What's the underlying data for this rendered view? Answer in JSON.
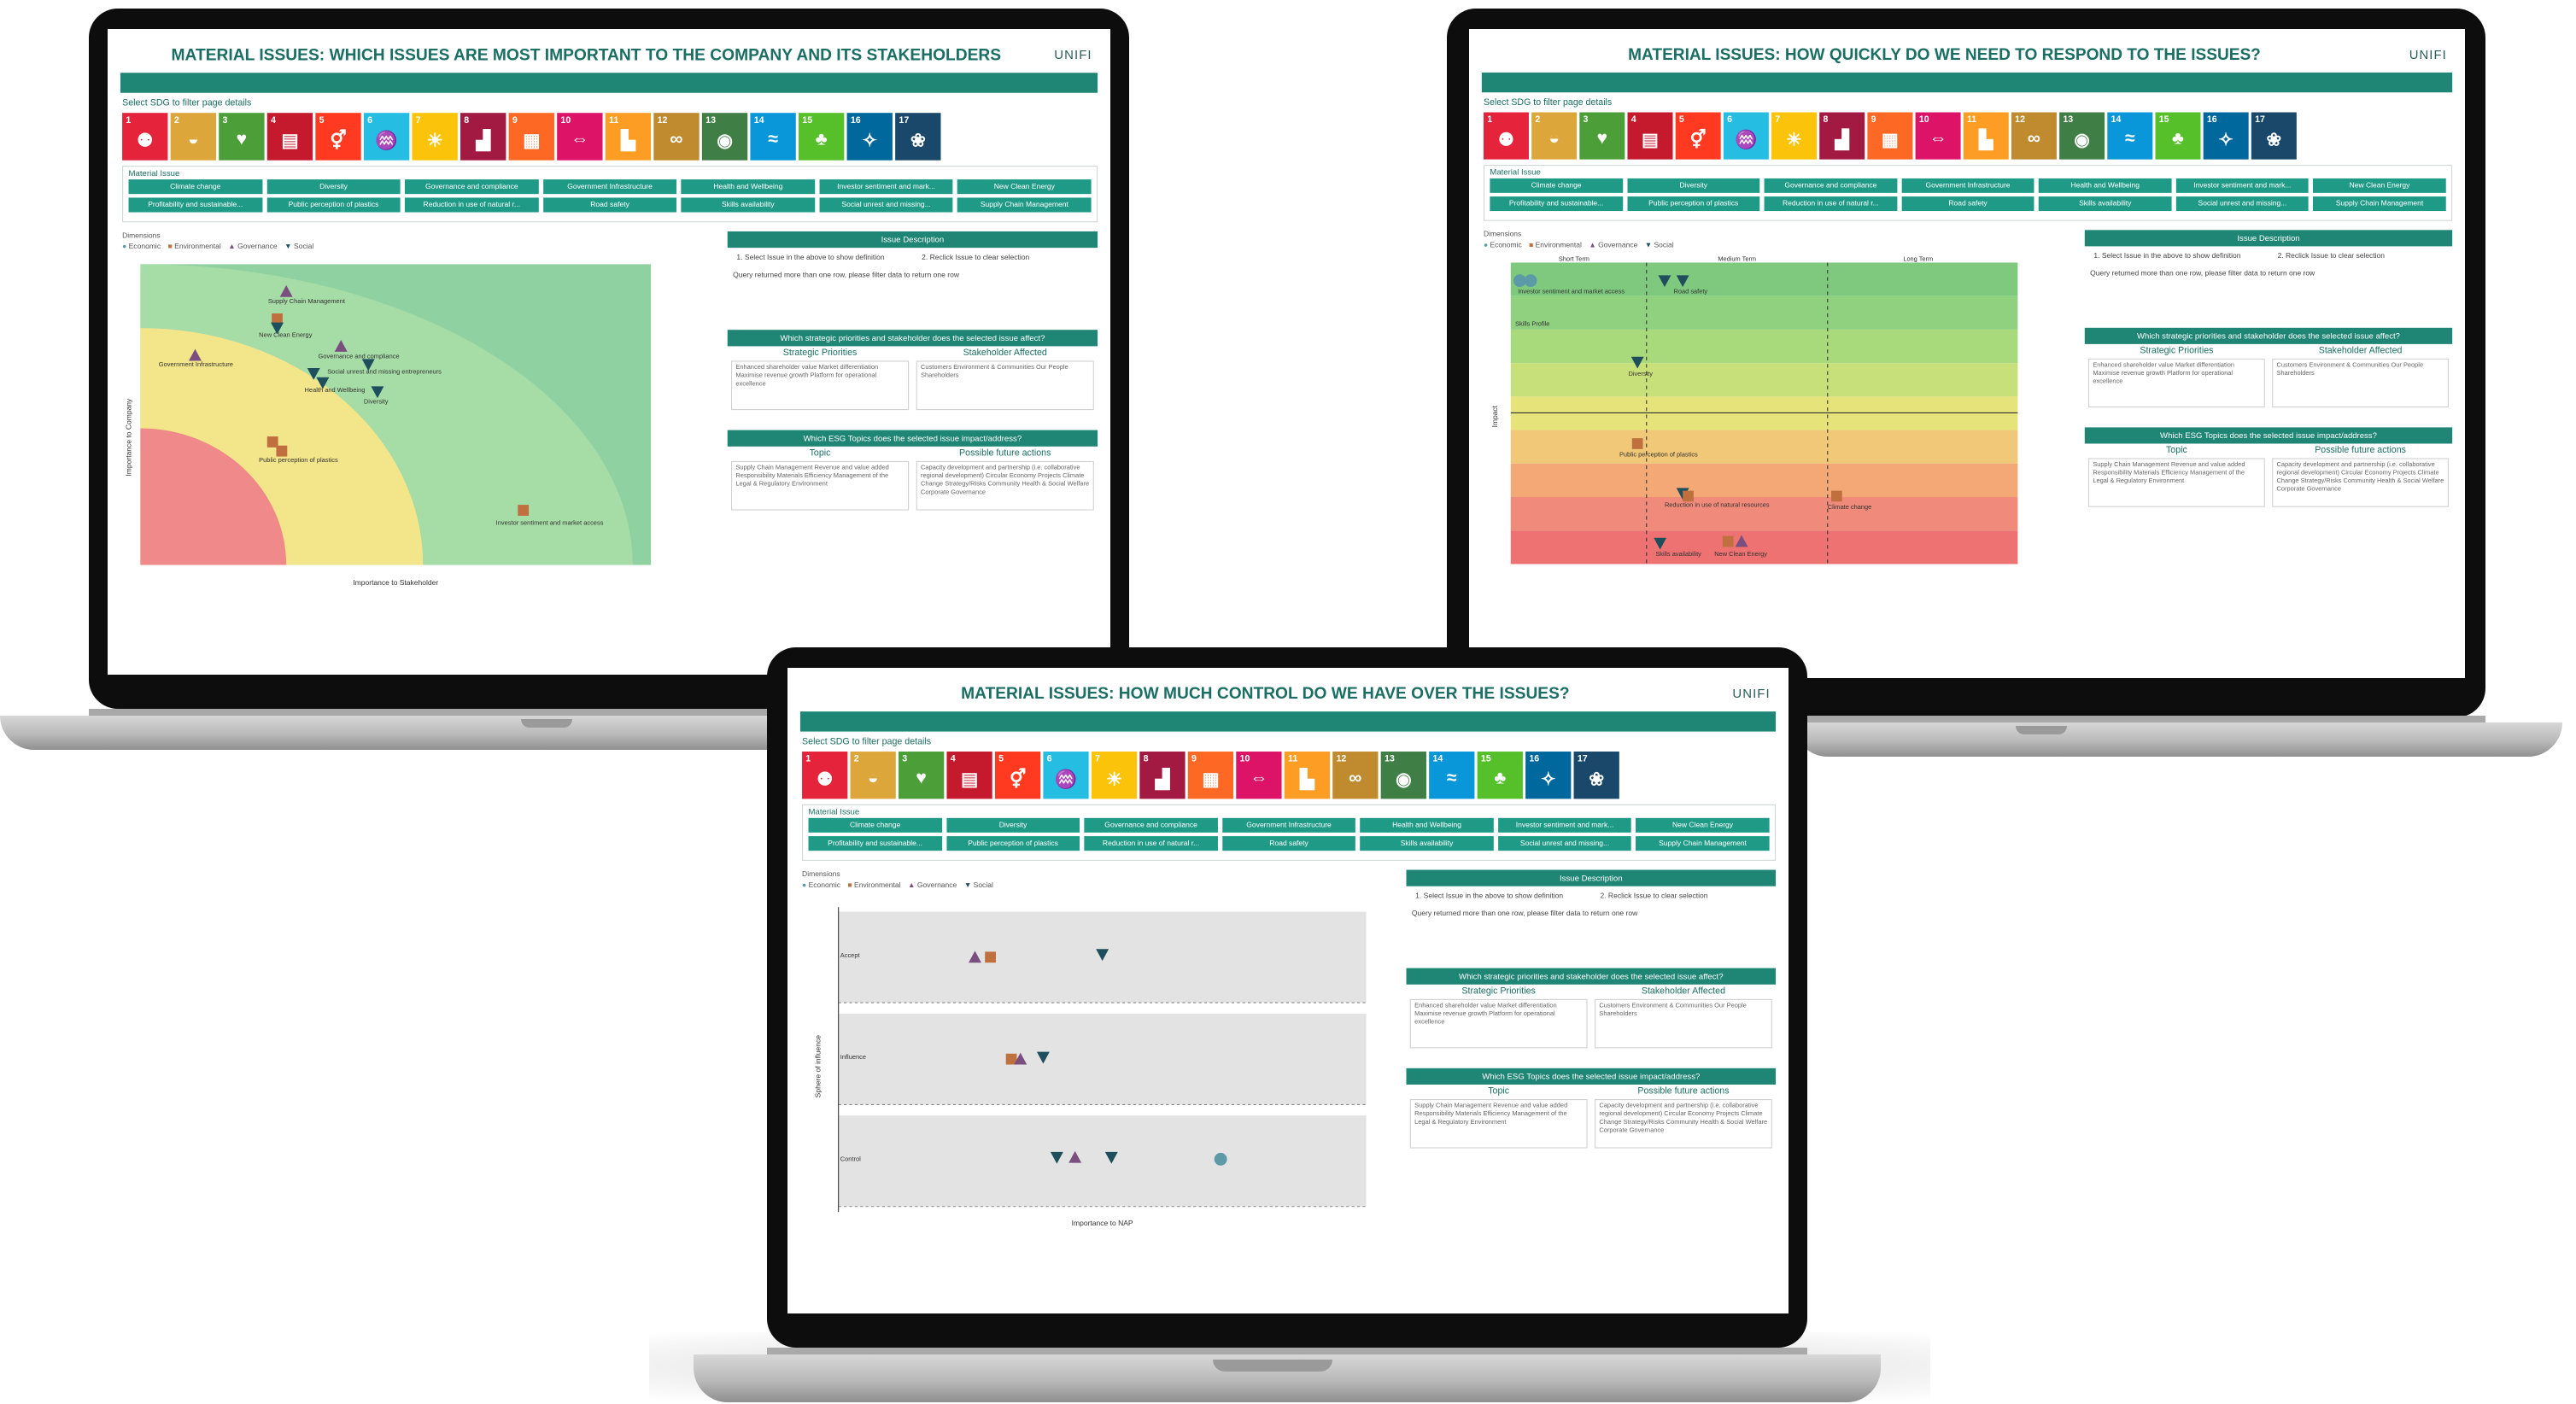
{
  "brand": {
    "logo": "UNIFI"
  },
  "colors": {
    "teal": "#1f8574",
    "title": "#1a6e63"
  },
  "common": {
    "sdg_prompt": "Select SDG to filter page details",
    "sdg_tiles": [
      {
        "n": "1",
        "color": "#e5243b",
        "icon": "people-icon"
      },
      {
        "n": "2",
        "color": "#dda63a",
        "icon": "bowl-icon"
      },
      {
        "n": "3",
        "color": "#4c9f38",
        "icon": "heartbeat-icon"
      },
      {
        "n": "4",
        "color": "#c5192d",
        "icon": "book-icon"
      },
      {
        "n": "5",
        "color": "#ff3a21",
        "icon": "gender-icon"
      },
      {
        "n": "6",
        "color": "#26bde2",
        "icon": "water-drop-icon"
      },
      {
        "n": "7",
        "color": "#fcc30b",
        "icon": "sun-icon"
      },
      {
        "n": "8",
        "color": "#a21942",
        "icon": "growth-chart-icon"
      },
      {
        "n": "9",
        "color": "#fd6925",
        "icon": "cubes-icon"
      },
      {
        "n": "10",
        "color": "#dd1367",
        "icon": "equality-icon"
      },
      {
        "n": "11",
        "color": "#fd9d24",
        "icon": "city-icon"
      },
      {
        "n": "12",
        "color": "#bf8b2e",
        "icon": "infinity-icon"
      },
      {
        "n": "13",
        "color": "#3f7e44",
        "icon": "eye-globe-icon"
      },
      {
        "n": "14",
        "color": "#0a97d9",
        "icon": "fish-icon"
      },
      {
        "n": "15",
        "color": "#56c02b",
        "icon": "tree-icon"
      },
      {
        "n": "16",
        "color": "#00689d",
        "icon": "dove-icon"
      },
      {
        "n": "17",
        "color": "#19486a",
        "icon": "flower-icon"
      }
    ],
    "material_issue_label": "Material Issue",
    "material_issues": [
      "Climate change",
      "Diversity",
      "Governance and compliance",
      "Government Infrastructure",
      "Health and Wellbeing",
      "Investor sentiment and mark...",
      "New Clean Energy",
      "Profitability and sustainable...",
      "Public perception of plastics",
      "Reduction in use of natural r...",
      "Road safety",
      "Skills availability",
      "Social unrest and missing...",
      "Supply Chain Management"
    ],
    "dimensions_label": "Dimensions",
    "legend": [
      "Economic",
      "Environmental",
      "Governance",
      "Social"
    ],
    "issue_description_head": "Issue Description",
    "step1": "1. Select Issue in the above to show definition",
    "step2": "2. Reclick Issue to clear selection",
    "query_msg": "Query returned more than one row, please filter data to return one row",
    "strategic_head": "Which strategic priorities and stakeholder does the selected issue affect?",
    "strategic_col": "Strategic Priorities",
    "stakeholder_col": "Stakeholder Affected",
    "strategic_items": "Enhanced shareholder value  Market differentiation  Maximise revenue growth  Platform for operational excellence",
    "stakeholder_items": "Customers  Environment & Communities  Our People  Shareholders",
    "esg_head": "Which ESG Topics does the selected issue impact/address?",
    "topic_col": "Topic",
    "actions_col": "Possible future actions",
    "topic_items": "Supply Chain Management  Revenue and value added  Responsibility  Materials Efficiency  Management of the Legal & Regulatory  Environment",
    "action_items": "Capacity development and partnership (i.e. collaborative regional development)  Circular Economy Projects  Climate Change Strategy/Risks  Community Health & Social Welfare  Corporate Governance"
  },
  "screens": [
    {
      "title": "MATERIAL ISSUES: WHICH ISSUES ARE MOST IMPORTANT TO THE COMPANY AND ITS STAKEHOLDERS",
      "xlabel": "Importance to Stakeholder",
      "ylabel": "Importance to Company",
      "labels": [
        "Supply Chain Management",
        "New Clean Energy",
        "Government Infrastructure",
        "Governance and compliance",
        "Social unrest and missing entrepreneurs",
        "Health and Wellbeing",
        "Diversity",
        "Public perception of plastics",
        "Investor sentiment and market access"
      ]
    },
    {
      "title": "MATERIAL ISSUES: HOW QUICKLY DO WE NEED TO RESPOND TO THE ISSUES?",
      "col_labels": [
        "Short Term",
        "Medium Term",
        "Long Term"
      ],
      "ylabel": "Impact",
      "labels": [
        "Investor sentiment and market access",
        "Road safety",
        "Skills Profile",
        "Diversity",
        "Public perception of plastics",
        "Reduction in use of natural resources",
        "Climate change",
        "Skills availability",
        "New Clean Energy"
      ]
    },
    {
      "title": "MATERIAL ISSUES: HOW MUCH CONTROL DO WE HAVE OVER THE ISSUES?",
      "xlabel": "Importance to NAP",
      "ylabel": "Sphere of influence",
      "rows": [
        "Accept",
        "Influence",
        "Control"
      ]
    }
  ]
}
